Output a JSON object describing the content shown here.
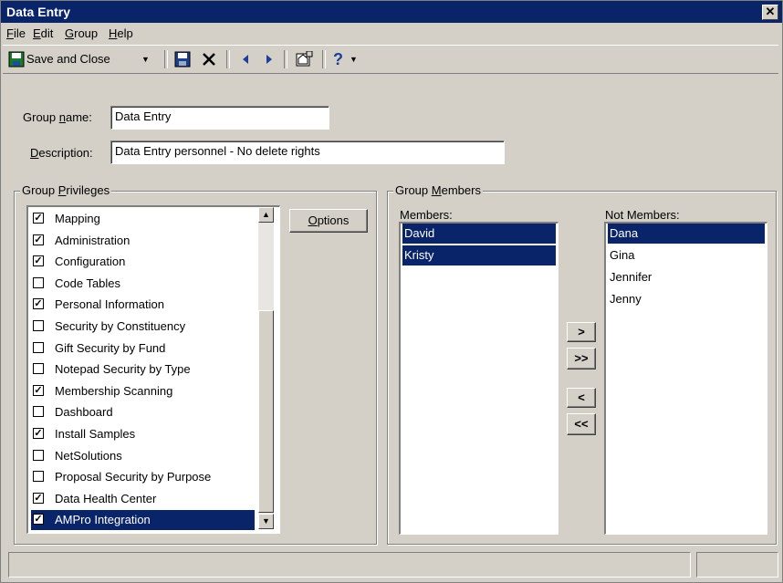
{
  "window": {
    "title": "Data Entry"
  },
  "menu": [
    {
      "key": "F",
      "rest": "ile"
    },
    {
      "key": "E",
      "rest": "dit"
    },
    {
      "key": "G",
      "rest": "roup"
    },
    {
      "key": "H",
      "rest": "elp"
    }
  ],
  "toolbar": {
    "save_close_label": "Save and Close"
  },
  "form": {
    "group_name_pre": "Group ",
    "group_name_key": "n",
    "group_name_post": "ame:",
    "group_name_value": "Data Entry",
    "description_key": "D",
    "description_post": "escription:",
    "description_value": "Data Entry personnel - No delete rights"
  },
  "privileges": {
    "legend_pre": "Group ",
    "legend_key": "P",
    "legend_post": "rivileges",
    "items": [
      {
        "label": "Mapping",
        "checked": true
      },
      {
        "label": "Administration",
        "checked": true
      },
      {
        "label": "Configuration",
        "checked": true
      },
      {
        "label": "Code Tables",
        "checked": false
      },
      {
        "label": "Personal Information",
        "checked": true
      },
      {
        "label": "Security by Constituency",
        "checked": false
      },
      {
        "label": "Gift Security by Fund",
        "checked": false
      },
      {
        "label": "Notepad Security by Type",
        "checked": false
      },
      {
        "label": "Membership Scanning",
        "checked": true
      },
      {
        "label": "Dashboard",
        "checked": false
      },
      {
        "label": "Install Samples",
        "checked": true
      },
      {
        "label": "NetSolutions",
        "checked": false
      },
      {
        "label": "Proposal Security by Purpose",
        "checked": false
      },
      {
        "label": "Data Health Center",
        "checked": true
      },
      {
        "label": "AMPro Integration",
        "checked": true,
        "selected": true
      }
    ],
    "options_key": "O",
    "options_rest": "ptions"
  },
  "members": {
    "legend_pre": "Group ",
    "legend_key": "M",
    "legend_post": "embers",
    "members_label": "Members:",
    "not_members_label": "Not Members:",
    "members_list": [
      "David",
      "Kristy"
    ],
    "not_members_list": [
      "Dana",
      "Gina",
      "Jennifer",
      "Jenny"
    ],
    "move_right": ">",
    "move_all_right": ">>",
    "move_left": "<",
    "move_all_left": "<<"
  }
}
